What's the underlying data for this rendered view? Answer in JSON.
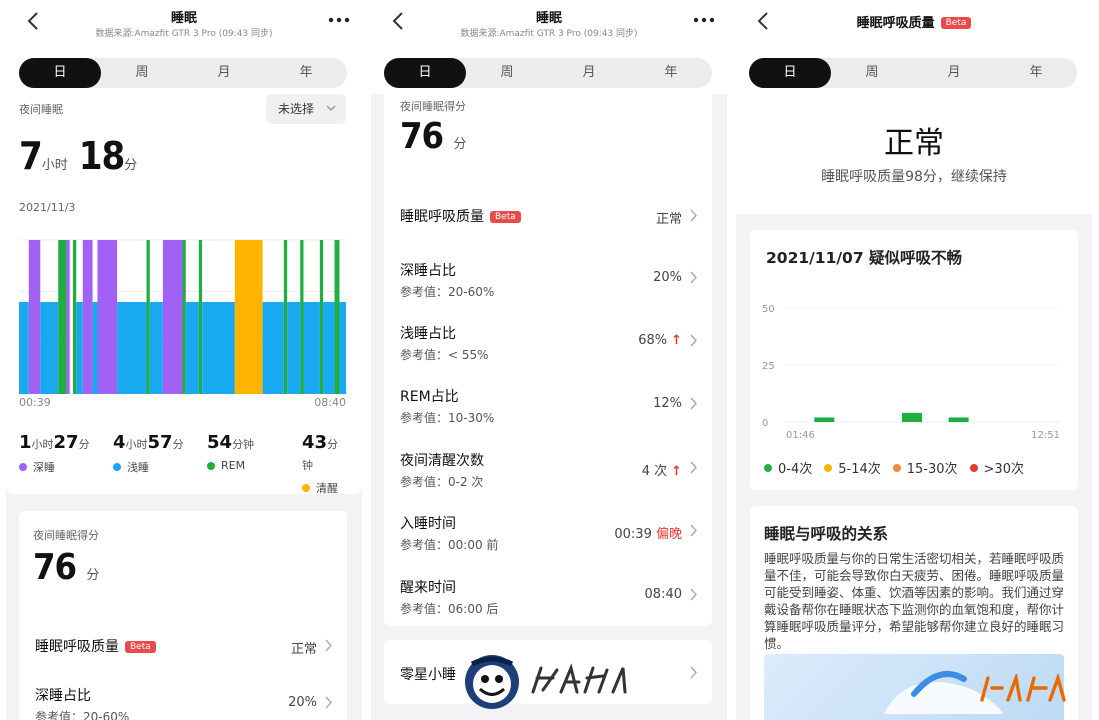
{
  "colors": {
    "deep": "#a161f5",
    "light": "#19a9f0",
    "rem": "#1fae3f",
    "awake": "#ffb400",
    "accent": "#111111",
    "warn": "#e53935"
  },
  "panel1": {
    "title": "睡眠",
    "source": "数据来源:Amazfit GTR 3 Pro (09:43 同步)",
    "tabs": [
      "日",
      "周",
      "月",
      "年"
    ],
    "night_sleep_label": "夜间睡眠",
    "dropdown": "未选择",
    "hours": "7",
    "hours_unit": "小时",
    "minutes": "18",
    "minutes_unit": "分",
    "date": "2021/11/3",
    "time_start": "00:39",
    "time_end": "08:40",
    "stats": [
      {
        "v1": "1",
        "u1": "小时",
        "v2": "27",
        "u2": "分",
        "label": "深睡",
        "color": "#a161f5"
      },
      {
        "v1": "4",
        "u1": "小时",
        "v2": "57",
        "u2": "分",
        "label": "浅睡",
        "color": "#19a9f0"
      },
      {
        "v1": "54",
        "u1": "分钟",
        "v2": "",
        "u2": "",
        "label": "REM",
        "color": "#1fae3f"
      },
      {
        "v1": "43",
        "u1": "分钟",
        "v2": "",
        "u2": "",
        "label": "清醒",
        "color": "#ffb400"
      }
    ],
    "score_label": "夜间睡眠得分",
    "score": "76",
    "score_unit": "分",
    "rows": [
      {
        "title": "睡眠呼吸质量",
        "beta": "Beta",
        "value": "正常"
      },
      {
        "title": "深睡占比",
        "sub": "参考值：20-60%",
        "value": "20%"
      }
    ]
  },
  "panel2": {
    "title": "睡眠",
    "source": "数据来源:Amazfit GTR 3 Pro (09:43 同步)",
    "tabs": [
      "日",
      "周",
      "月",
      "年"
    ],
    "score_label": "夜间睡眠得分",
    "score": "76",
    "score_unit": "分",
    "rows": [
      {
        "title": "睡眠呼吸质量",
        "beta": "Beta",
        "value": "正常"
      },
      {
        "title": "深睡占比",
        "sub": "参考值：20-60%",
        "value": "20%"
      },
      {
        "title": "浅睡占比",
        "sub": "参考值：< 55%",
        "value": "68%",
        "flag": "↑"
      },
      {
        "title": "REM占比",
        "sub": "参考值：10-30%",
        "value": "12%"
      },
      {
        "title": "夜间清醒次数",
        "sub": "参考值：0-2 次",
        "value": "4 次",
        "flag": "↑"
      },
      {
        "title": "入睡时间",
        "sub": "参考值：00:00 前",
        "value": "00:39",
        "flag": "偏晚"
      },
      {
        "title": "醒来时间",
        "sub": "参考值：06:00 后",
        "value": "08:40"
      }
    ],
    "nap": "零星小睡"
  },
  "panel3": {
    "title": "睡眠呼吸质量",
    "beta": "Beta",
    "tabs": [
      "日",
      "周",
      "月",
      "年"
    ],
    "status": "正常",
    "status_sub": "睡眠呼吸质量98分，继续保持",
    "chart_title": "2021/11/07 疑似呼吸不畅",
    "legend": [
      {
        "label": "0-4次",
        "color": "#1fae3f"
      },
      {
        "label": "5-14次",
        "color": "#ffb400"
      },
      {
        "label": "15-30次",
        "color": "#f08a3c"
      },
      {
        "label": ">30次",
        "color": "#e53935"
      }
    ],
    "relation_title": "睡眠与呼吸的关系",
    "relation_text": "睡眠呼吸质量与你的日常生活密切相关，若睡眠呼吸质量不佳，可能会导致你白天疲劳、困倦。睡眠呼吸质量可能受到睡姿、体重、饮酒等因素的影响。我们通过穿戴设备帮你在睡眠状态下监测你的血氧饱和度，帮你计算睡眠呼吸质量评分，希望能够帮你建立良好的睡眠习惯。"
  },
  "chart_data": [
    {
      "type": "bar",
      "title": "",
      "x_range": [
        "00:39",
        "08:40"
      ],
      "stages": [
        "深睡",
        "浅睡",
        "REM",
        "清醒"
      ],
      "segments": [
        {
          "stage": "浅睡",
          "start": 0.0,
          "end": 0.03
        },
        {
          "stage": "深睡",
          "start": 0.03,
          "end": 0.065
        },
        {
          "stage": "浅睡",
          "start": 0.065,
          "end": 0.12
        },
        {
          "stage": "REM",
          "start": 0.12,
          "end": 0.145
        },
        {
          "stage": "深睡",
          "start": 0.145,
          "end": 0.155
        },
        {
          "stage": "REM",
          "start": 0.165,
          "end": 0.175
        },
        {
          "stage": "浅睡",
          "start": 0.175,
          "end": 0.195
        },
        {
          "stage": "深睡",
          "start": 0.195,
          "end": 0.225
        },
        {
          "stage": "浅睡",
          "start": 0.225,
          "end": 0.24
        },
        {
          "stage": "深睡",
          "start": 0.24,
          "end": 0.3
        },
        {
          "stage": "浅睡",
          "start": 0.3,
          "end": 0.39
        },
        {
          "stage": "REM",
          "start": 0.39,
          "end": 0.4
        },
        {
          "stage": "浅睡",
          "start": 0.4,
          "end": 0.44
        },
        {
          "stage": "深睡",
          "start": 0.44,
          "end": 0.5
        },
        {
          "stage": "REM",
          "start": 0.5,
          "end": 0.51
        },
        {
          "stage": "浅睡",
          "start": 0.51,
          "end": 0.55
        },
        {
          "stage": "REM",
          "start": 0.55,
          "end": 0.56
        },
        {
          "stage": "浅睡",
          "start": 0.56,
          "end": 0.66
        },
        {
          "stage": "清醒",
          "start": 0.66,
          "end": 0.745
        },
        {
          "stage": "浅睡",
          "start": 0.745,
          "end": 0.81
        },
        {
          "stage": "REM",
          "start": 0.81,
          "end": 0.82
        },
        {
          "stage": "浅睡",
          "start": 0.82,
          "end": 0.86
        },
        {
          "stage": "REM",
          "start": 0.86,
          "end": 0.87
        },
        {
          "stage": "浅睡",
          "start": 0.87,
          "end": 0.92
        },
        {
          "stage": "REM",
          "start": 0.92,
          "end": 0.93
        },
        {
          "stage": "浅睡",
          "start": 0.93,
          "end": 0.965
        },
        {
          "stage": "REM",
          "start": 0.965,
          "end": 0.98
        },
        {
          "stage": "浅睡",
          "start": 0.98,
          "end": 1.0
        }
      ]
    },
    {
      "type": "bar",
      "title": "2021/11/07 疑似呼吸不畅",
      "x_range": [
        "01:46",
        "12:51"
      ],
      "ylim": [
        0,
        50
      ],
      "yticks": [
        0,
        25,
        50
      ],
      "bars": [
        {
          "x": 0.14,
          "value": 2,
          "level": "0-4次"
        },
        {
          "x": 0.46,
          "value": 4,
          "level": "0-4次"
        },
        {
          "x": 0.63,
          "value": 2,
          "level": "0-4次"
        }
      ]
    }
  ]
}
